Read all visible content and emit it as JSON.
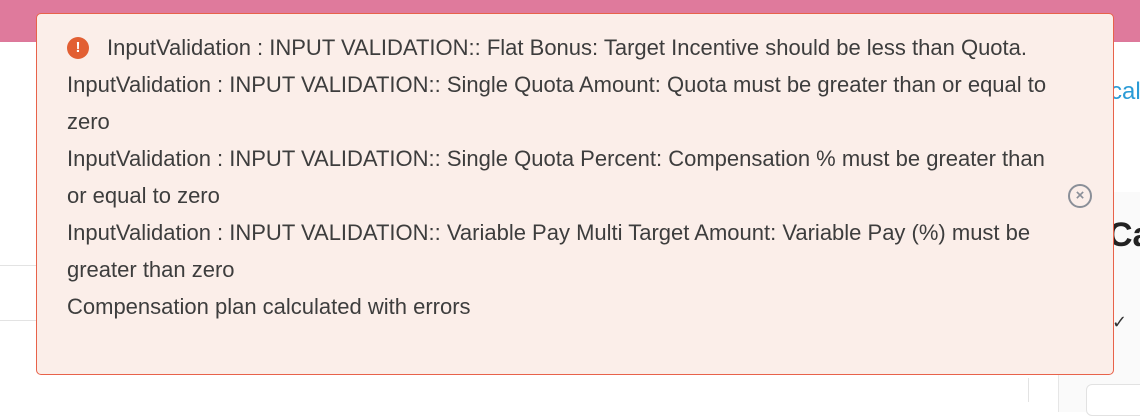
{
  "background": {
    "side_link_text": "cal",
    "side_title_text": "Ca",
    "side_chevron": "✓"
  },
  "toast": {
    "severity": "error",
    "icon": "exclamation-icon",
    "icon_glyph": "!",
    "close_glyph": "×",
    "colors": {
      "background": "#fbeee9",
      "border": "#e8624a",
      "icon": "#e25f33",
      "text": "#3d3d3d"
    },
    "messages": [
      "InputValidation : INPUT VALIDATION:: Flat Bonus: Target Incentive should be less than Quota.",
      "InputValidation : INPUT VALIDATION:: Single Quota Amount: Quota must be greater than or equal to zero",
      "InputValidation : INPUT VALIDATION:: Single Quota Percent: Compensation % must be greater than or equal to zero",
      "InputValidation : INPUT VALIDATION:: Variable Pay Multi Target Amount: Variable Pay (%) must be greater than zero",
      "Compensation plan calculated with errors"
    ]
  },
  "colors": {
    "top_bar": "#df7a9c",
    "link": "#2a9bd6"
  }
}
